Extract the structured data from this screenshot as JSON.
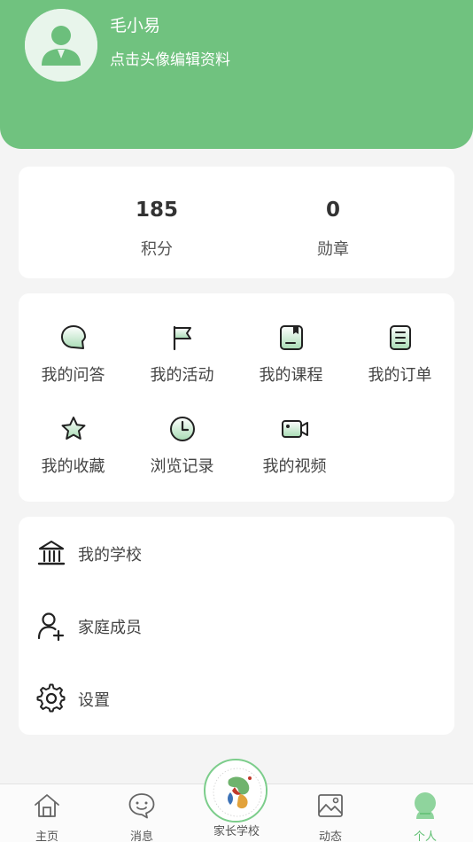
{
  "header": {
    "user_name": "毛小易",
    "subtitle": "点击头像编辑资料",
    "avatar_icon": "user-avatar-icon",
    "background_color": "#70c27f"
  },
  "stats": [
    {
      "value": "185",
      "label": "积分"
    },
    {
      "value": "0",
      "label": "勋章"
    }
  ],
  "grid": [
    {
      "label": "我的问答",
      "icon": "chat-bubble-icon"
    },
    {
      "label": "我的活动",
      "icon": "flag-icon"
    },
    {
      "label": "我的课程",
      "icon": "course-book-icon"
    },
    {
      "label": "我的订单",
      "icon": "order-list-icon"
    },
    {
      "label": "我的收藏",
      "icon": "star-icon"
    },
    {
      "label": "浏览记录",
      "icon": "clock-icon"
    },
    {
      "label": "我的视频",
      "icon": "video-camera-icon"
    }
  ],
  "list": [
    {
      "label": "我的学校",
      "icon": "school-building-icon"
    },
    {
      "label": "家庭成员",
      "icon": "add-person-icon"
    },
    {
      "label": "设置",
      "icon": "gear-icon"
    }
  ],
  "tabbar": {
    "tabs": [
      {
        "label": "主页",
        "icon": "home-icon"
      },
      {
        "label": "消息",
        "icon": "message-icon"
      },
      {
        "label": "动态",
        "icon": "image-icon"
      },
      {
        "label": "个人",
        "icon": "person-icon"
      }
    ],
    "center_label": "家长学校",
    "center_icon": "school-logo-icon",
    "active_color": "#5fbf72"
  }
}
